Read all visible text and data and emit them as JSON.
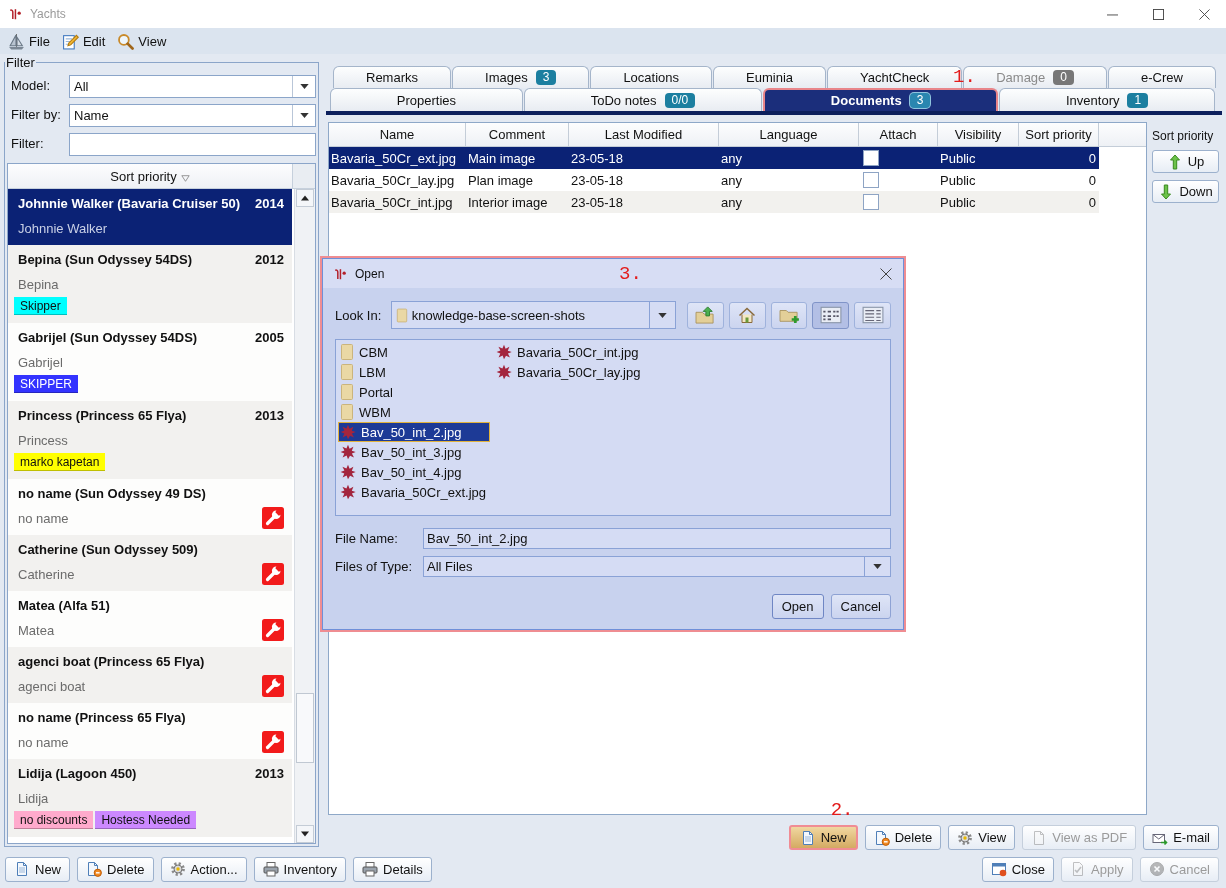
{
  "window": {
    "title": "Yachts"
  },
  "menu": [
    {
      "label": "File",
      "kind": "sailboat"
    },
    {
      "label": "Edit",
      "kind": "pencil"
    },
    {
      "label": "View",
      "kind": "magnifier"
    }
  ],
  "filter": {
    "title": "Filter",
    "fields": [
      {
        "label": "Model:",
        "kind": "combo",
        "value": "All"
      },
      {
        "label": "Filter by:",
        "kind": "combo",
        "value": "Name"
      },
      {
        "label": "Filter:",
        "kind": "text"
      }
    ]
  },
  "yachts": {
    "header": "Sort priority",
    "items": [
      {
        "title": "Johnnie Walker (Bavaria Cruiser 50)",
        "year": "2014",
        "subtitle": "Johnnie Walker",
        "selected": true,
        "service": false
      },
      {
        "title": "Bepina (Sun Odyssey 54DS)",
        "year": "2012",
        "subtitle": "Bepina",
        "selected": false,
        "service": false,
        "tags": [
          {
            "label": "Skipper",
            "color": "#00ffff"
          }
        ]
      },
      {
        "title": "Gabrijel (Sun Odyssey 54DS)",
        "year": "2005",
        "subtitle": "Gabrijel",
        "selected": false,
        "service": false,
        "tags": [
          {
            "label": "SKIPPER",
            "color": "#3333ff"
          }
        ]
      },
      {
        "title": "Princess (Princess 65 Flya)",
        "year": "2013",
        "subtitle": "Princess",
        "selected": false,
        "service": false,
        "tags": [
          {
            "label": "marko kapetan",
            "color": "#ffff00"
          }
        ]
      },
      {
        "title": "no name (Sun Odyssey 49 DS)",
        "subtitle": "no name",
        "selected": false,
        "service": true
      },
      {
        "title": "Catherine (Sun Odyssey 509)",
        "subtitle": "Catherine",
        "selected": false,
        "service": true
      },
      {
        "title": "Matea (Alfa 51)",
        "subtitle": "Matea",
        "selected": false,
        "service": true
      },
      {
        "title": "agenci boat (Princess 65 Flya)",
        "subtitle": "agenci boat",
        "selected": false,
        "service": true
      },
      {
        "title": "no name (Princess 65 Flya)",
        "subtitle": "no name",
        "selected": false,
        "service": true
      },
      {
        "title": "Lidija (Lagoon 450)",
        "year": "2013",
        "subtitle": "Lidija",
        "selected": false,
        "service": false,
        "tags": [
          {
            "label": "no discounts",
            "color": "#ffaacc"
          },
          {
            "label": "Hostess Needed",
            "color": "#cc88ff"
          }
        ]
      }
    ]
  },
  "tabs": {
    "callout": "1.",
    "rows": [
      {
        "tabs": [
          {
            "label": "Remarks",
            "selected": false,
            "disabled": false,
            "highlighted": false
          },
          {
            "label": "Images",
            "badge": "3",
            "selected": false,
            "disabled": false,
            "highlighted": false
          },
          {
            "label": "Locations",
            "selected": false,
            "disabled": false,
            "highlighted": false
          },
          {
            "label": "Euminia",
            "selected": false,
            "disabled": false,
            "highlighted": false
          },
          {
            "label": "YachtCheck",
            "selected": false,
            "disabled": false,
            "highlighted": false
          },
          {
            "label": "Damage",
            "badge": "0",
            "selected": false,
            "disabled": true,
            "highlighted": false
          },
          {
            "label": "e-Crew",
            "selected": false,
            "disabled": false,
            "highlighted": false
          }
        ]
      },
      {
        "tabs": [
          {
            "label": "Properties",
            "selected": false,
            "disabled": false,
            "highlighted": false
          },
          {
            "label": "ToDo notes",
            "badge": "0/0",
            "selected": false,
            "disabled": false,
            "highlighted": false
          },
          {
            "label": "Documents",
            "badge": "3",
            "selected": true,
            "disabled": false,
            "highlighted": true
          },
          {
            "label": "Inventory",
            "badge": "1",
            "selected": false,
            "disabled": false,
            "highlighted": false
          }
        ]
      }
    ]
  },
  "documents": {
    "columns": [
      "Name",
      "Comment",
      "Last Modified",
      "Language",
      "Attach",
      "Visibility",
      "Sort priority"
    ],
    "rows": [
      {
        "name": "Bavaria_50Cr_ext.jpg",
        "comment": "Main image",
        "last_modified": "23-05-18",
        "language": "any",
        "attach": false,
        "visibility": "Public",
        "sort_priority": "0",
        "selected": true
      },
      {
        "name": "Bavaria_50Cr_lay.jpg",
        "comment": "Plan image",
        "last_modified": "23-05-18",
        "language": "any",
        "attach": false,
        "visibility": "Public",
        "sort_priority": "0",
        "selected": false
      },
      {
        "name": "Bavaria_50Cr_int.jpg",
        "comment": "Interior image",
        "last_modified": "23-05-18",
        "language": "any",
        "attach": false,
        "visibility": "Public",
        "sort_priority": "0",
        "selected": false
      }
    ]
  },
  "sort_panel": {
    "label": "Sort priority",
    "buttons": [
      {
        "label": "Up",
        "kind": "up"
      },
      {
        "label": "Down",
        "kind": "down"
      }
    ]
  },
  "document_buttons": {
    "callout": "2.",
    "items": [
      {
        "label": "New",
        "kind": "new",
        "highlighted": true,
        "disabled": false
      },
      {
        "label": "Delete",
        "kind": "delete",
        "highlighted": false,
        "disabled": false
      },
      {
        "label": "View",
        "kind": "gear",
        "highlighted": false,
        "disabled": false
      },
      {
        "label": "View as PDF",
        "kind": "pdf",
        "highlighted": false,
        "disabled": true
      },
      {
        "label": "E-mail",
        "kind": "email",
        "highlighted": false,
        "disabled": false
      }
    ]
  },
  "dialog": {
    "title": "Open",
    "callout": "3.",
    "highlighted": true,
    "look_in": {
      "label": "Look In:",
      "value": "knowledge-base-screen-shots"
    },
    "toolbar": [
      {
        "kind": "up",
        "selected": false
      },
      {
        "kind": "home",
        "selected": false
      },
      {
        "kind": "new-folder",
        "selected": false
      },
      {
        "kind": "list",
        "selected": true
      },
      {
        "kind": "details",
        "selected": false
      }
    ],
    "files": [
      {
        "name": "CBM",
        "kind": "folder",
        "selected": false
      },
      {
        "name": "LBM",
        "kind": "folder",
        "selected": false
      },
      {
        "name": "Portal",
        "kind": "folder",
        "selected": false
      },
      {
        "name": "WBM",
        "kind": "folder",
        "selected": false
      },
      {
        "name": "Bav_50_int_2.jpg",
        "kind": "image",
        "selected": true
      },
      {
        "name": "Bav_50_int_3.jpg",
        "kind": "image",
        "selected": false
      },
      {
        "name": "Bav_50_int_4.jpg",
        "kind": "image",
        "selected": false
      },
      {
        "name": "Bavaria_50Cr_ext.jpg",
        "kind": "image",
        "selected": false
      },
      {
        "name": "Bavaria_50Cr_int.jpg",
        "kind": "image",
        "selected": false
      },
      {
        "name": "Bavaria_50Cr_lay.jpg",
        "kind": "image",
        "selected": false
      }
    ],
    "file_name": {
      "label": "File Name:",
      "value": "Bav_50_int_2.jpg"
    },
    "file_type": {
      "label": "Files of Type:",
      "value": "All Files"
    },
    "buttons": [
      {
        "label": "Open"
      },
      {
        "label": "Cancel"
      }
    ]
  },
  "bottom_buttons": {
    "left": [
      {
        "label": "New",
        "kind": "new",
        "disabled": false
      },
      {
        "label": "Delete",
        "kind": "delete",
        "disabled": false
      },
      {
        "label": "Action...",
        "kind": "gear",
        "disabled": false
      },
      {
        "label": "Inventory",
        "kind": "printer",
        "disabled": false
      },
      {
        "label": "Details",
        "kind": "printer",
        "disabled": false
      }
    ],
    "right": [
      {
        "label": "Close",
        "kind": "close",
        "disabled": false
      },
      {
        "label": "Apply",
        "kind": "apply",
        "disabled": true
      },
      {
        "label": "Cancel",
        "kind": "cancel",
        "disabled": true
      }
    ]
  }
}
